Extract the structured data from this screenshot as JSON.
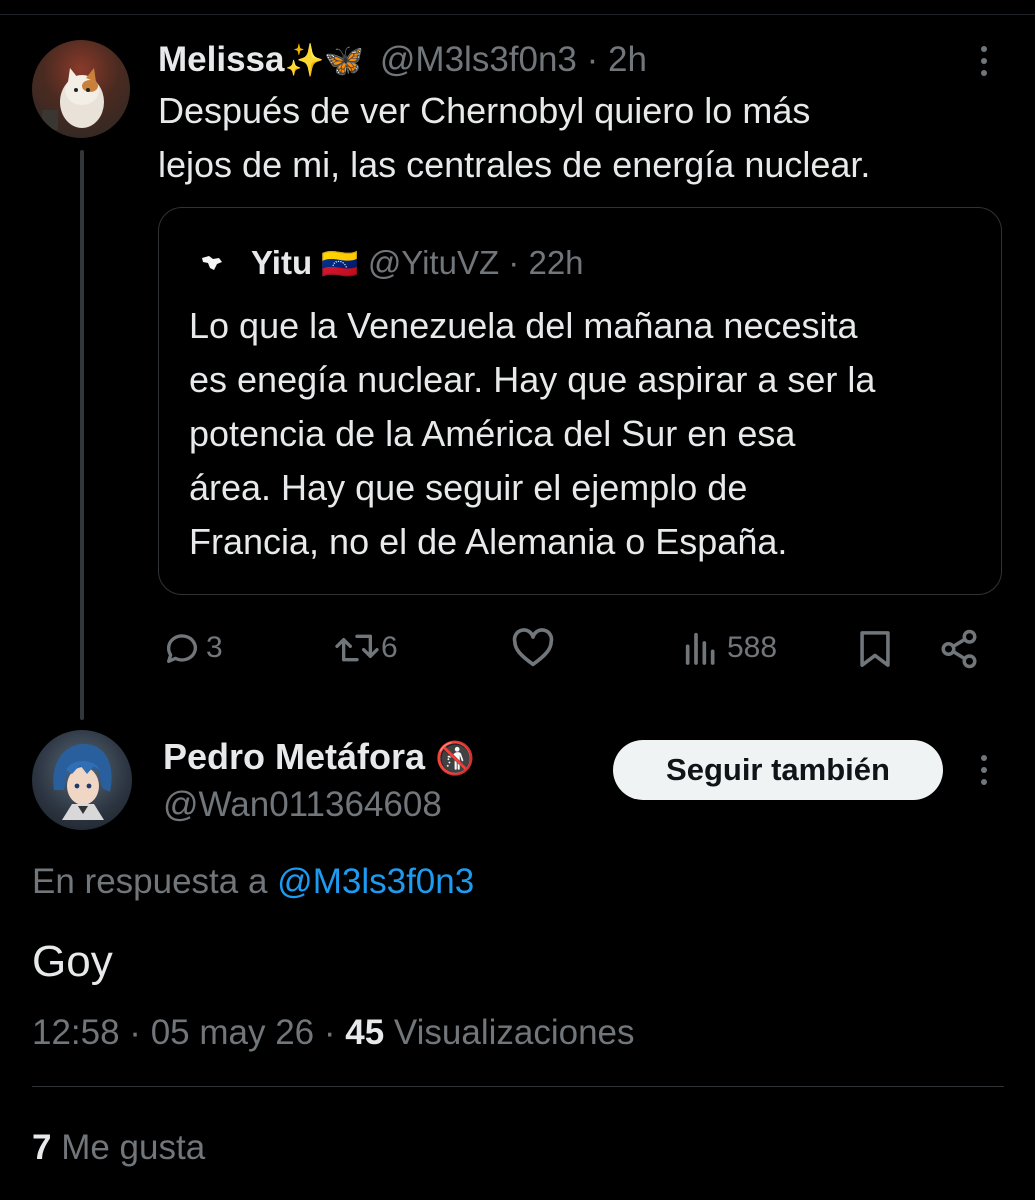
{
  "tweet": {
    "author_name": "Melissa",
    "author_emoji": "✨🦋",
    "handle": "@M3ls3f0n3",
    "separator": "·",
    "time": "2h",
    "text_line1": "Después de ver Chernobyl quiero lo más",
    "text_line2": "lejos de mi, las centrales de energía nuclear.",
    "quote": {
      "author_name": "Yitu",
      "flag": "🇻🇪",
      "handle": "@YituVZ",
      "time": "22h",
      "lines": [
        "Lo que la Venezuela del mañana necesita",
        "es enegía nuclear. Hay que aspirar a ser la",
        "potencia de la América del Sur en esa",
        "área. Hay que seguir el ejemplo de",
        "Francia, no el de Alemania o España."
      ]
    },
    "actions": {
      "replies": "3",
      "retweets": "6",
      "views": "588"
    }
  },
  "reply": {
    "author_name": "Pedro Metáfora",
    "author_emoji": "🚯",
    "handle": "@Wan011364608",
    "follow_label": "Seguir también",
    "in_reply_prefix": "En respuesta a",
    "in_reply_handle": "@M3ls3f0n3",
    "text": "Goy",
    "meta_time": "12:58 · 05 may 26 ·",
    "meta_views_count": "45",
    "meta_views_label": "Visualizaciones",
    "likes_count": "7",
    "likes_label": "Me gusta"
  },
  "colors": {
    "background": "#000000",
    "text": "#e7e9ea",
    "muted": "#71767b",
    "link": "#1d9bf0",
    "border": "#2f3336"
  },
  "icons": [
    "reply-icon",
    "retweet-icon",
    "like-icon",
    "views-icon",
    "bookmark-icon",
    "share-icon",
    "more-icon"
  ]
}
